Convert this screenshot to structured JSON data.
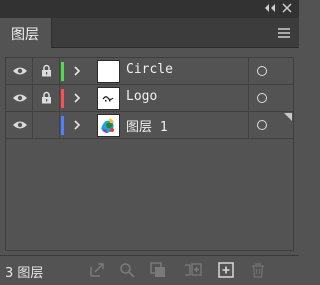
{
  "panel": {
    "tab_label": "图层",
    "collapse_glyph": "◂◂",
    "close_glyph": "✕"
  },
  "layers": [
    {
      "name": "Circle",
      "color": "#4fdc4f",
      "visible": true,
      "locked": true,
      "thumb": "blank-white"
    },
    {
      "name": "Logo",
      "color": "#ff4f4f",
      "visible": true,
      "locked": true,
      "thumb": "logo-mark"
    },
    {
      "name": "图层 1",
      "color": "#4f7fff",
      "visible": true,
      "locked": false,
      "thumb": "colorful-swirl",
      "selected": true
    }
  ],
  "footer": {
    "count_label": "3 图层",
    "buttons": [
      "export-icon",
      "search-icon",
      "clipping-mask-icon",
      "new-sublayer-icon",
      "new-layer-icon",
      "trash-icon"
    ]
  },
  "colors": {
    "panel_bg": "#535353",
    "topbar_bg": "#323232",
    "tabrow_bg": "#3c3c3c"
  }
}
